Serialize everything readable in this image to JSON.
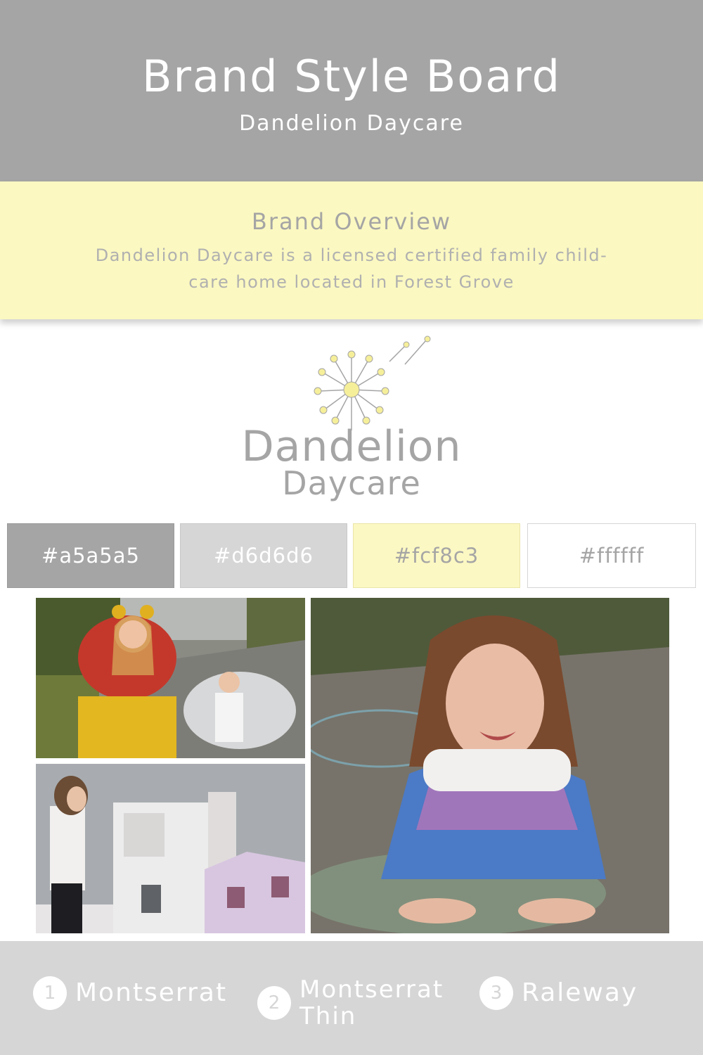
{
  "header": {
    "title": "Brand Style Board",
    "subtitle": "Dandelion Daycare"
  },
  "overview": {
    "heading": "Brand Overview",
    "text": "Dandelion Daycare is a licensed certified family child-care home located in Forest Grove"
  },
  "logo": {
    "line1": "Dandelion",
    "line2": "Daycare",
    "icon": "dandelion-icon"
  },
  "palette": [
    {
      "hex": "#a5a5a5",
      "label": "#a5a5a5",
      "text_color": "#ffffff"
    },
    {
      "hex": "#d6d6d6",
      "label": "#d6d6d6",
      "text_color": "#ffffff"
    },
    {
      "hex": "#fcf8c3",
      "label": "#fcf8c3",
      "text_color": "#a5a5a5"
    },
    {
      "hex": "#ffffff",
      "label": "#ffffff",
      "text_color": "#a5a5a5"
    }
  ],
  "fonts": [
    {
      "number": "1",
      "name": "Montserrat"
    },
    {
      "number": "2",
      "name": "Montserrat Thin"
    },
    {
      "number": "3",
      "name": "Raleway"
    }
  ]
}
